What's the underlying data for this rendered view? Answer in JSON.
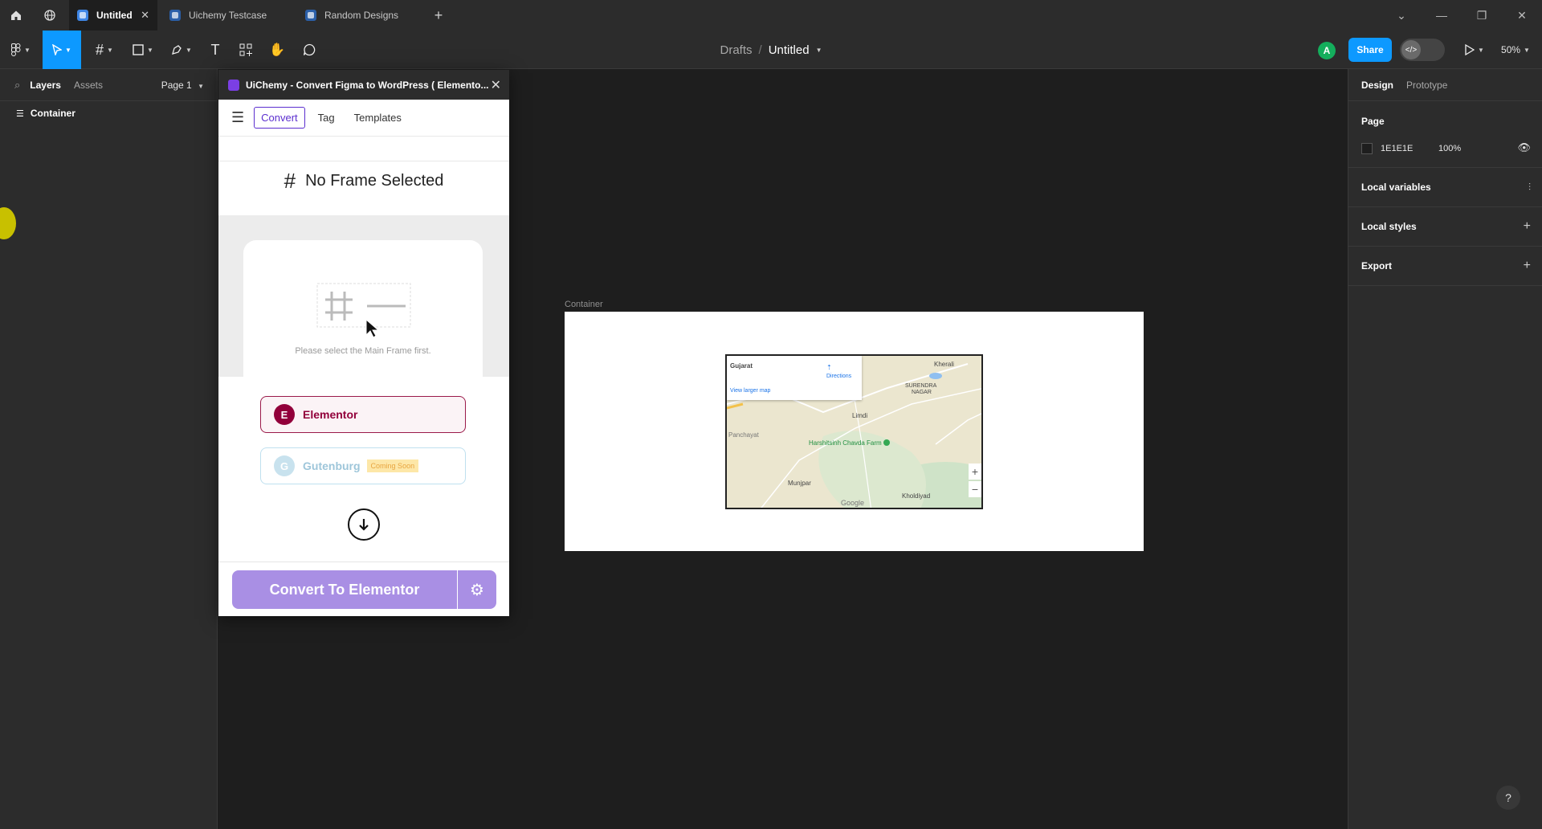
{
  "tabs": [
    {
      "label": "Untitled",
      "active": true
    },
    {
      "label": "Uichemy Testcase",
      "active": false
    },
    {
      "label": "Random Designs",
      "active": false
    }
  ],
  "breadcrumb": {
    "drafts": "Drafts",
    "separator": "/",
    "file": "Untitled"
  },
  "toolbar": {
    "avatar_initial": "A",
    "share_label": "Share",
    "zoom": "50%"
  },
  "left_panel": {
    "tabs": [
      "Layers",
      "Assets"
    ],
    "page_selector": "Page 1",
    "layers": [
      "Container"
    ]
  },
  "plugin": {
    "title": "UiChemy - Convert Figma to WordPress ( Elemento...",
    "nav": [
      "Convert",
      "Tag",
      "Templates"
    ],
    "status": "No Frame Selected",
    "empty_hint": "Please select the Main Frame first.",
    "builders": [
      {
        "label": "Elementor",
        "icon_letter": "E"
      },
      {
        "label": "Gutenburg",
        "icon_letter": "G",
        "badge": "Coming Soon"
      }
    ],
    "convert_label": "Convert To Elementor"
  },
  "canvas": {
    "frame_label": "Container",
    "map": {
      "region": "Gujarat",
      "directions": "Directions",
      "larger_map": "View larger map",
      "places": [
        "Kherali",
        "SURENDRA",
        "NAGAR",
        "Limdi",
        "Panchayat",
        "Harshitsinh Chavda Farm",
        "Munjpar",
        "Kholdiyad",
        "Google"
      ]
    }
  },
  "right_panel": {
    "tabs": [
      "Design",
      "Prototype"
    ],
    "page_heading": "Page",
    "page_color": "1E1E1E",
    "page_opacity": "100%",
    "sections": [
      "Local variables",
      "Local styles",
      "Export"
    ]
  },
  "colors": {
    "accent": "#0d99ff",
    "plugin_purple": "#a98fe4",
    "elementor": "#92003b"
  }
}
